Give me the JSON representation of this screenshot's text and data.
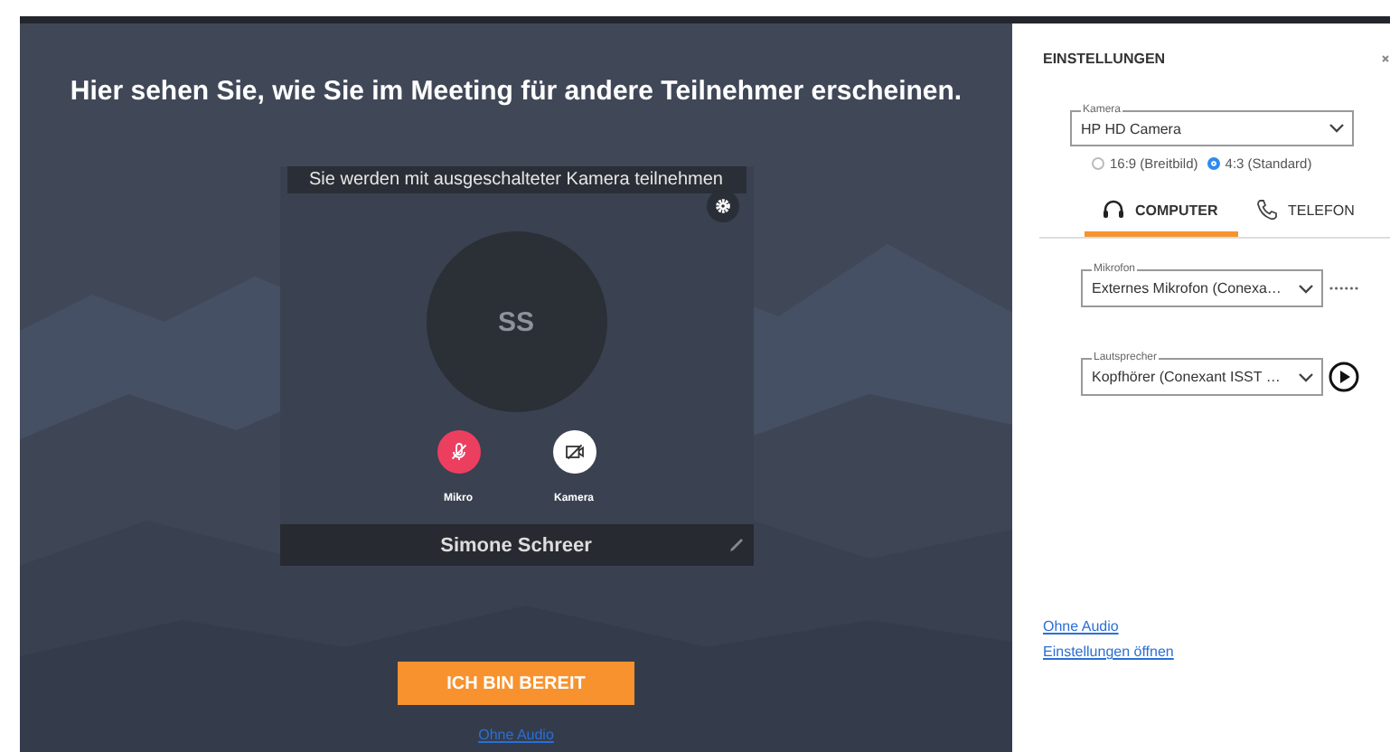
{
  "headline": "Hier sehen Sie, wie Sie im Meeting für andere Teilnehmer erscheinen.",
  "preview": {
    "notice": "Sie werden mit ausgeschalteter Kamera teilnehmen",
    "initials": "SS",
    "name": "Simone Schreer",
    "controls": [
      {
        "label": "Mikro",
        "kind": "mic",
        "on": false
      },
      {
        "label": "Kamera",
        "kind": "camera",
        "on": false
      }
    ]
  },
  "ready_button": "ICH BIN BEREIT",
  "bottom_link": "Ohne Audio",
  "settings": {
    "title": "EINSTELLUNGEN",
    "camera": {
      "label": "Kamera",
      "value": "HP HD Camera"
    },
    "aspect_options": [
      {
        "label": "16:9 (Breitbild)",
        "selected": false
      },
      {
        "label": "4:3 (Standard)",
        "selected": true
      }
    ],
    "tabs": [
      {
        "label": "COMPUTER",
        "kind": "headset",
        "selected": true
      },
      {
        "label": "TELEFON",
        "kind": "phone",
        "selected": false
      }
    ],
    "microphone": {
      "label": "Mikrofon",
      "value": "Externes Mikrofon (Conexa…"
    },
    "speaker": {
      "label": "Lautsprecher",
      "value": "Kopfhörer (Conexant ISST …"
    },
    "links": [
      "Ohne Audio",
      "Einstellungen öffnen"
    ]
  }
}
